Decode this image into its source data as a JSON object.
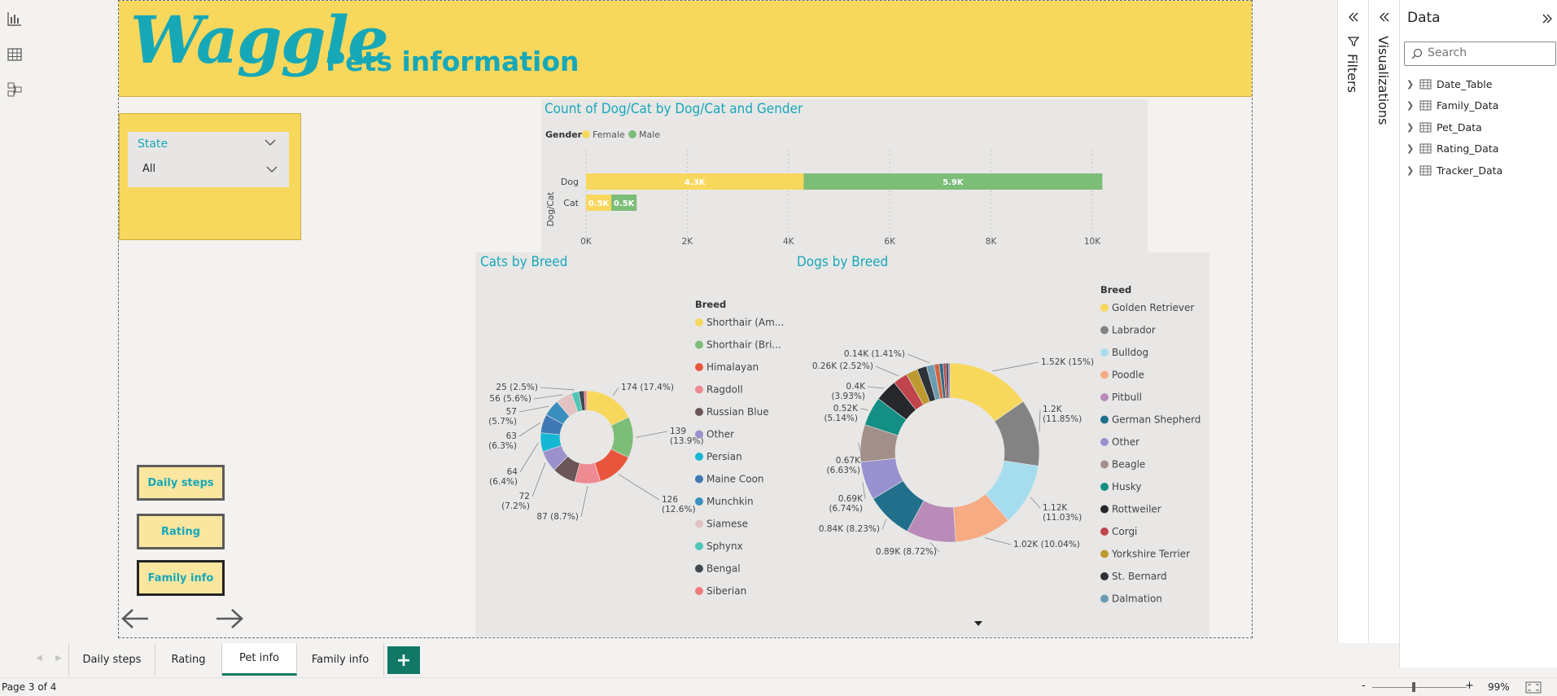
{
  "app": {
    "logo_text": "Waggle",
    "page_title": "Pets information"
  },
  "slicer": {
    "title": "State",
    "value": "All"
  },
  "bar_visual": {
    "title": "Count of Dog/Cat by Dog/Cat and Gender",
    "legend_title": "Gender",
    "legend": [
      {
        "name": "Female",
        "color": "#f8d85c"
      },
      {
        "name": "Male",
        "color": "#7cbd78"
      }
    ]
  },
  "cats_visual": {
    "title": "Cats by Breed",
    "legend_title": "Breed"
  },
  "dogs_visual": {
    "title": "Dogs by Breed",
    "legend_title": "Breed"
  },
  "chart_data": [
    {
      "type": "bar",
      "orientation": "horizontal",
      "stacked": true,
      "title": "Count of Dog/Cat by Dog/Cat and Gender",
      "ylabel": "Dog/Cat",
      "categories": [
        "Dog",
        "Cat"
      ],
      "series": [
        {
          "name": "Female",
          "values": [
            4300,
            500
          ],
          "labels": [
            "4.3K",
            "0.5K"
          ],
          "color": "#f8d85c"
        },
        {
          "name": "Male",
          "values": [
            5900,
            500
          ],
          "labels": [
            "5.9K",
            "0.5K"
          ],
          "color": "#7cbd78"
        }
      ],
      "xlim": [
        0,
        10000
      ],
      "xticks": [
        "0K",
        "2K",
        "4K",
        "6K",
        "8K",
        "10K"
      ],
      "legend_position": "top-left"
    },
    {
      "type": "pie",
      "donut": true,
      "title": "Cats by Breed",
      "legend_title": "Breed",
      "legend_position": "right",
      "slices": [
        {
          "name": "Shorthair (Am...",
          "value": 174,
          "label": "174 (17.4%)",
          "color": "#f8d85c"
        },
        {
          "name": "Shorthair (Bri...",
          "value": 139,
          "label": "139\n(13.9%)",
          "color": "#7cbd78"
        },
        {
          "name": "Himalayan",
          "value": 126,
          "label": "126\n(12.6%)",
          "color": "#e8553c"
        },
        {
          "name": "Ragdoll",
          "value": 87,
          "label": "87 (8.7%)",
          "color": "#ef8a92"
        },
        {
          "name": "Russian Blue",
          "value": 80,
          "label": "",
          "color": "#6b5559"
        },
        {
          "name": "Other",
          "value": 72,
          "label": "72\n(7.2%)",
          "color": "#9b91cc"
        },
        {
          "name": "Persian",
          "value": 64,
          "label": "64\n(6.4%)",
          "color": "#15b7d3"
        },
        {
          "name": "Maine Coon",
          "value": 63,
          "label": "63\n(6.3%)",
          "color": "#3f78b4"
        },
        {
          "name": "Munchkin",
          "value": 57,
          "label": "57\n(5.7%)",
          "color": "#3a8fbf"
        },
        {
          "name": "Siamese",
          "value": 56,
          "label": "56 (5.6%)",
          "color": "#e3c2c4"
        },
        {
          "name": "Sphynx",
          "value": 25,
          "label": "25 (2.5%)",
          "color": "#4fc6b6"
        },
        {
          "name": "Bengal",
          "value": 18,
          "label": "",
          "color": "#3f4a4f"
        },
        {
          "name": "Siberian",
          "value": 9,
          "label": "",
          "color": "#f27b7b"
        }
      ]
    },
    {
      "type": "pie",
      "donut": true,
      "title": "Dogs by Breed",
      "legend_title": "Breed",
      "legend_position": "right",
      "slices": [
        {
          "name": "Golden Retriever",
          "value": 1520,
          "label": "1.52K (15%)",
          "color": "#f8d85c"
        },
        {
          "name": "Labrador",
          "value": 1200,
          "label": "1.2K\n(11.85%)",
          "color": "#838383"
        },
        {
          "name": "Bulldog",
          "value": 1120,
          "label": "1.12K\n(11.03%)",
          "color": "#a6ddee"
        },
        {
          "name": "Poodle",
          "value": 1020,
          "label": "1.02K (10.04%)",
          "color": "#f7ab83"
        },
        {
          "name": "Pitbull",
          "value": 890,
          "label": "0.89K (8.72%)",
          "color": "#b98bb8"
        },
        {
          "name": "German Shepherd",
          "value": 840,
          "label": "0.84K (8.23%)",
          "color": "#226f8b"
        },
        {
          "name": "Other",
          "value": 690,
          "label": "0.69K\n(6.74%)",
          "color": "#9891cf"
        },
        {
          "name": "Beagle",
          "value": 670,
          "label": "0.67K\n(6.63%)",
          "color": "#a38f8a"
        },
        {
          "name": "Husky",
          "value": 520,
          "label": "0.52K\n(5.14%)",
          "color": "#148f85"
        },
        {
          "name": "Rottweiler",
          "value": 400,
          "label": "0.4K\n(3.93%)",
          "color": "#25272b"
        },
        {
          "name": "Corgi",
          "value": 260,
          "label": "0.26K (2.52%)",
          "color": "#c0444b"
        },
        {
          "name": "Yorkshire Terrier",
          "value": 210,
          "label": "",
          "color": "#bd9a30"
        },
        {
          "name": "St. Bernard",
          "value": 170,
          "label": "",
          "color": "#2c3238"
        },
        {
          "name": "Dalmation",
          "value": 140,
          "label": "0.14K (1.41%)",
          "color": "#6b9bb1"
        },
        {
          "name": "",
          "value": 90,
          "label": "",
          "color": "#d0663f"
        },
        {
          "name": "",
          "value": 70,
          "label": "",
          "color": "#2f6b87"
        },
        {
          "name": "",
          "value": 50,
          "label": "",
          "color": "#b54a55"
        },
        {
          "name": "",
          "value": 40,
          "label": "",
          "color": "#333333"
        },
        {
          "name": "",
          "value": 30,
          "label": "",
          "color": "#7b6ec0"
        }
      ]
    }
  ],
  "nav_buttons": [
    {
      "label": "Daily steps"
    },
    {
      "label": "Rating"
    },
    {
      "label": "Family info"
    }
  ],
  "panes": {
    "filters_label": "Filters",
    "visualizations_label": "Visualizations",
    "data_title": "Data",
    "search_placeholder": "Search",
    "tables": [
      "Date_Table",
      "Family_Data",
      "Pet_Data",
      "Rating_Data",
      "Tracker_Data"
    ]
  },
  "page_tabs": [
    "Daily steps",
    "Rating",
    "Pet info",
    "Family info"
  ],
  "active_tab": "Pet info",
  "status": {
    "page_text": "Page 3 of 4",
    "zoom": "99%"
  },
  "colors": {
    "accent": "#17a8b8",
    "brand_yellow": "#f8d85c",
    "active_tab": "#117865"
  }
}
